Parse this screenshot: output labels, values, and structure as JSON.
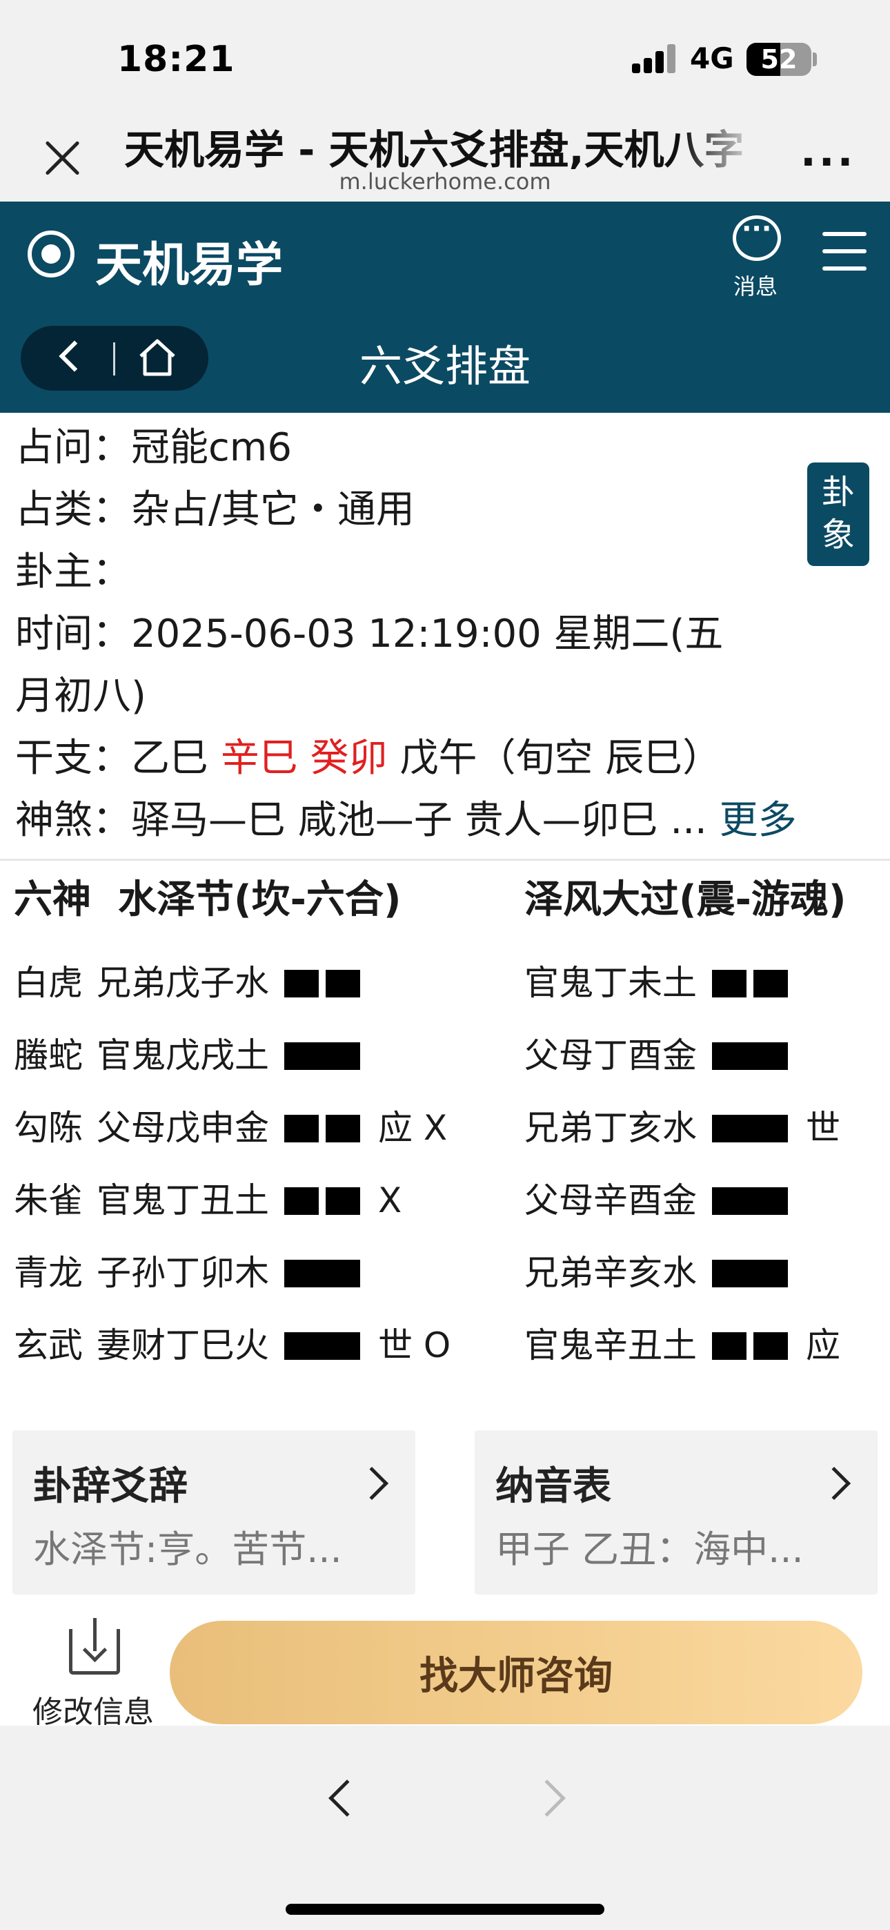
{
  "status_bar": {
    "time": "18:21",
    "network": "4G",
    "battery": "52",
    "battery_level": 0.52
  },
  "browser": {
    "title": "天机易学 - 天机六爻排盘,天机八字",
    "url": "m.luckerhome.com"
  },
  "header": {
    "brand": "天机易学",
    "message_label": "消息",
    "section_title": "六爻排盘"
  },
  "info": {
    "question_label": "占问：",
    "question": "冠能cm6",
    "category_label": "占类：",
    "category": "杂占/其它・通用",
    "owner_label": "卦主：",
    "owner": "",
    "time_label": "时间：",
    "time_line1": "2025-06-03 12:19:00   星期二(五",
    "time_line2": "月初八)",
    "ganzhi_label": "干支：",
    "ganzhi_1": "乙巳",
    "ganzhi_2": "辛巳",
    "ganzhi_3": "癸卯",
    "ganzhi_4": "戊午",
    "xunkong": "（旬空   辰巳）",
    "shensha_label": "神煞：",
    "shensha": "驿马—巳  咸池—子  贵人—卯巳  ...",
    "more": "更多",
    "gua_xiang_button": [
      "卦",
      "象"
    ]
  },
  "hexagram": {
    "liushen_header": "六神",
    "main_name": "水泽节(坎-六合)",
    "changed_name": "泽风大过(震-游魂)",
    "main_lines": [
      {
        "god": "白虎",
        "text": "兄弟戊子水",
        "yin": true,
        "mark": ""
      },
      {
        "god": "螣蛇",
        "text": "官鬼戊戌土",
        "yin": false,
        "mark": ""
      },
      {
        "god": "勾陈",
        "text": "父母戊申金",
        "yin": true,
        "mark": "应 X"
      },
      {
        "god": "朱雀",
        "text": "官鬼丁丑土",
        "yin": true,
        "mark": "X"
      },
      {
        "god": "青龙",
        "text": "子孙丁卯木",
        "yin": false,
        "mark": ""
      },
      {
        "god": "玄武",
        "text": "妻财丁巳火",
        "yin": false,
        "mark": "世 O"
      }
    ],
    "changed_lines": [
      {
        "text": "官鬼丁未土",
        "yin": true,
        "mark": ""
      },
      {
        "text": "父母丁酉金",
        "yin": false,
        "mark": ""
      },
      {
        "text": "兄弟丁亥水",
        "yin": false,
        "mark": "世"
      },
      {
        "text": "父母辛酉金",
        "yin": false,
        "mark": ""
      },
      {
        "text": "兄弟辛亥水",
        "yin": false,
        "mark": ""
      },
      {
        "text": "官鬼辛丑土",
        "yin": true,
        "mark": "应"
      }
    ]
  },
  "cards": {
    "left": {
      "title": "卦辞爻辞",
      "subtitle": "水泽节:亨。苦节..."
    },
    "right": {
      "title": "纳音表",
      "subtitle": "甲子 乙丑：海中..."
    }
  },
  "actions": {
    "edit_label": "修改信息",
    "consult_label": "找大师咨询"
  },
  "colors": {
    "header": "#0b4a63",
    "red": "#e02020",
    "button_gold": "#f2cc8c"
  },
  "icons": [
    "close-icon",
    "more-icon",
    "logo-icon",
    "message-icon",
    "menu-icon",
    "back-icon",
    "home-icon",
    "chevron-right-icon",
    "edit-info-icon",
    "browser-back-icon",
    "browser-forward-icon"
  ]
}
